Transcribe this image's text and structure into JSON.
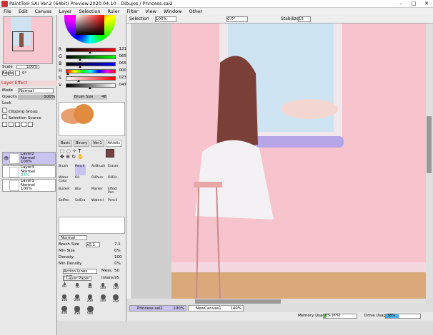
{
  "window": {
    "title": "PaintTool SAI Ver.2 (64bit) Preview.2020.04.10 - Dibujos / Princess.sai2",
    "minimize": "–",
    "maximize": "□",
    "close": "✕"
  },
  "menu": [
    "File",
    "Edit",
    "Canvas",
    "Layer",
    "Selection",
    "Ruler",
    "Filter",
    "View",
    "Window",
    "Other"
  ],
  "navigator": {
    "scale_label": "Scale",
    "scale_value": "100%",
    "angle_label": "Angle",
    "angle_value": "0°"
  },
  "layer_effect": {
    "header": "Layer Effect",
    "mode_label": "Mode",
    "mode_value": "Normal",
    "opacity_label": "Opacity",
    "opacity_value": "100%",
    "lock_label": "Lock",
    "clipping": "Clipping Group",
    "selection_source": "Selection Source"
  },
  "layers": [
    {
      "name": "Layer2",
      "mode": "Normal",
      "opacity": "100%",
      "selected": true
    },
    {
      "name": "Layer3",
      "mode": "Normal",
      "opacity": "25%",
      "selected": false
    },
    {
      "name": "Layer1",
      "mode": "Normal",
      "opacity": "100%",
      "selected": false
    }
  ],
  "color": {
    "sliders": [
      {
        "label": "R",
        "value": "121",
        "level": 0.47
      },
      {
        "label": "G",
        "value": "065",
        "level": 0.25
      },
      {
        "label": "B",
        "value": "065",
        "level": 0.25
      },
      {
        "label": "H",
        "value": "000",
        "level": 0.0
      },
      {
        "label": "S",
        "value": "023",
        "level": 0.23
      },
      {
        "label": "V",
        "value": "047",
        "level": 0.47
      }
    ],
    "current_color": "#7a4141"
  },
  "brush": {
    "label": "Brush Size",
    "value": "48"
  },
  "tool_tabs": [
    "Basic",
    "Binary",
    "Ver.1",
    "Artistic"
  ],
  "tools": [
    "Brush",
    "Pencil",
    "AirBrush",
    "Eraser",
    "Water Color",
    "Oil",
    "OilPure",
    "OilDir...",
    "Bucket",
    "Blur",
    "Marker",
    "Effect Pen",
    "SelPen",
    "SelEra",
    "Watercl",
    "Pencil"
  ],
  "brush_settings": {
    "mode": "Normal",
    "size_label": "Brush Size",
    "size_mult": "x0.1",
    "size_value": "7.1",
    "min_size_label": "Min Size",
    "min_size_value": "0%",
    "density_label": "Density",
    "density_value": "100",
    "min_density_label": "Min Density",
    "min_density_value": "0%",
    "texture": "Action Lines Larg",
    "texture_label": "Mess.",
    "texture_value": "50",
    "paper": "[ Layer Paper ]",
    "paper_label": "Intens.",
    "paper_value": "95"
  },
  "brush_sizes": [
    "60",
    "70",
    "80",
    "100",
    "120",
    "160",
    "200",
    "250",
    "300",
    "350",
    "400",
    "450",
    "500"
  ],
  "canvas_toolbar": {
    "zoom": "100%",
    "angle": "0.0°",
    "selection": "Selection",
    "stabilizer_label": "Stabilizer",
    "stabilizer_value": "15"
  },
  "doc_tabs": [
    {
      "name": "Princess.sai2",
      "zoom": "100%"
    },
    {
      "name": "NewCanvas1",
      "zoom": "140%"
    }
  ],
  "status": {
    "memory_label": "Memory Usage",
    "memory_value": "6% (6%)",
    "memory_level": 0.06,
    "drive_label": "Drive Usage",
    "drive_value": "38%",
    "drive_level": 0.38
  }
}
